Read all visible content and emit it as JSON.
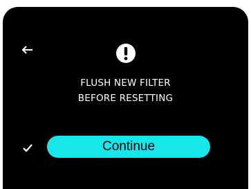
{
  "screen": {
    "icons": {
      "back": "left-arrow-icon",
      "alert": "exclamation-icon",
      "confirm": "checkmark-icon"
    },
    "message_line_1": "FLUSH NEW FILTER",
    "message_line_2": "BEFORE RESETTING",
    "continue_label": "Continue"
  },
  "colors": {
    "background": "#000000",
    "accent": "#17e6ea",
    "text": "#ffffff"
  }
}
